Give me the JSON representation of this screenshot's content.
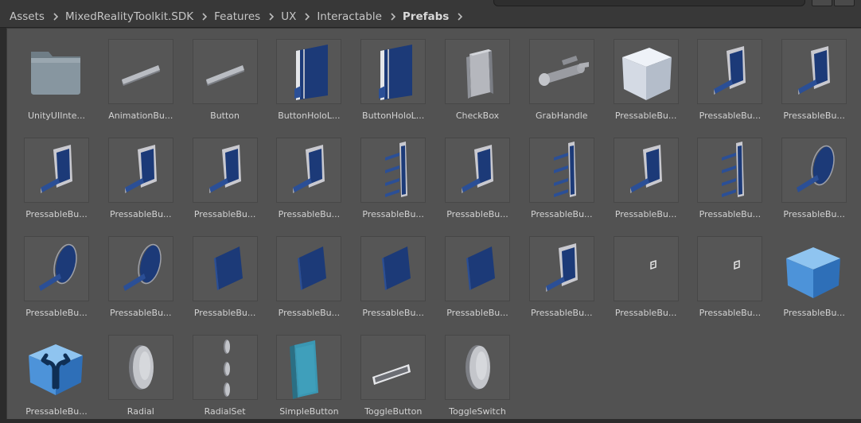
{
  "breadcrumb": [
    "Assets",
    "MixedRealityToolkit.SDK",
    "Features",
    "UX",
    "Interactable",
    "Prefabs"
  ],
  "assets": [
    {
      "label": "UnityUIInte...",
      "icon": "folder-icon"
    },
    {
      "label": "AnimationBu...",
      "icon": "flat-button-prefab-icon"
    },
    {
      "label": "Button",
      "icon": "flat-button-prefab-icon"
    },
    {
      "label": "ButtonHoloL...",
      "icon": "holo-button-prefab-icon"
    },
    {
      "label": "ButtonHoloL...",
      "icon": "holo-button-prefab-icon"
    },
    {
      "label": "CheckBox",
      "icon": "checkbox-prefab-icon"
    },
    {
      "label": "GrabHandle",
      "icon": "grab-handle-prefab-icon"
    },
    {
      "label": "PressableBu...",
      "icon": "white-cube-icon"
    },
    {
      "label": "PressableBu...",
      "icon": "pressable-button-prefab-icon"
    },
    {
      "label": "PressableBu...",
      "icon": "pressable-button-prefab-icon"
    },
    {
      "label": "PressableBu...",
      "icon": "pressable-button-prefab-icon"
    },
    {
      "label": "PressableBu...",
      "icon": "pressable-button-prefab-icon"
    },
    {
      "label": "PressableBu...",
      "icon": "pressable-button-prefab-icon"
    },
    {
      "label": "PressableBu...",
      "icon": "pressable-button-prefab-icon"
    },
    {
      "label": "PressableBu...",
      "icon": "button-bar-prefab-icon"
    },
    {
      "label": "PressableBu...",
      "icon": "pressable-button-prefab-icon"
    },
    {
      "label": "PressableBu...",
      "icon": "button-bar-prefab-icon"
    },
    {
      "label": "PressableBu...",
      "icon": "pressable-button-prefab-icon"
    },
    {
      "label": "PressableBu...",
      "icon": "button-bar-prefab-icon"
    },
    {
      "label": "PressableBu...",
      "icon": "round-button-prefab-icon"
    },
    {
      "label": "PressableBu...",
      "icon": "round-button-prefab-icon"
    },
    {
      "label": "PressableBu...",
      "icon": "round-button-prefab-icon"
    },
    {
      "label": "PressableBu...",
      "icon": "blue-panel-prefab-icon"
    },
    {
      "label": "PressableBu...",
      "icon": "blue-panel-prefab-icon"
    },
    {
      "label": "PressableBu...",
      "icon": "blue-panel-prefab-icon"
    },
    {
      "label": "PressableBu...",
      "icon": "blue-panel-prefab-icon"
    },
    {
      "label": "PressableBu...",
      "icon": "pressable-button-prefab-icon"
    },
    {
      "label": "PressableBu...",
      "icon": "small-icon-prefab-icon"
    },
    {
      "label": "PressableBu...",
      "icon": "small-icon-prefab-icon"
    },
    {
      "label": "PressableBu...",
      "icon": "blue-cube-icon"
    },
    {
      "label": "PressableBu...",
      "icon": "blue-cube-arrows-icon"
    },
    {
      "label": "Radial",
      "icon": "radial-disc-prefab-icon"
    },
    {
      "label": "RadialSet",
      "icon": "radial-set-prefab-icon"
    },
    {
      "label": "SimpleButton",
      "icon": "simple-button-prefab-icon"
    },
    {
      "label": "ToggleButton",
      "icon": "toggle-button-prefab-icon"
    },
    {
      "label": "ToggleSwitch",
      "icon": "radial-disc-prefab-icon"
    }
  ]
}
